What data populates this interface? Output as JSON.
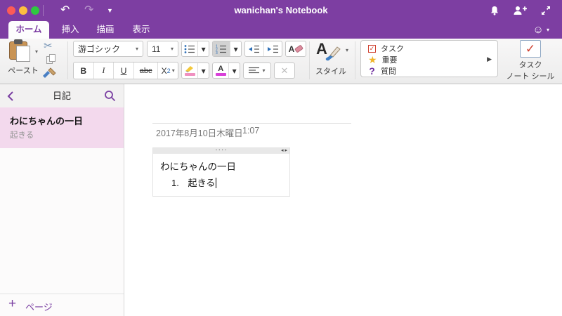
{
  "titlebar": {
    "title": "wanichan's Notebook"
  },
  "tabs": {
    "home": "ホーム",
    "insert": "挿入",
    "draw": "描画",
    "view": "表示"
  },
  "ribbon": {
    "paste_label": "ペースト",
    "font_name": "游ゴシック",
    "font_size": "11",
    "bold": "B",
    "italic": "I",
    "underline": "U",
    "strikethrough": "abc",
    "subscript_base": "X",
    "subscript_sub": "2",
    "clear_format_letter": "A",
    "font_color_letter": "A",
    "style_letter": "A",
    "style_label": "スタイル",
    "tags": {
      "task": "タスク",
      "important": "重要",
      "question": "質問"
    },
    "tag_button_line1": "タスク",
    "tag_button_line2": "ノート シール"
  },
  "sidebar": {
    "section_title": "日記",
    "page_title": "わにちゃんの一日",
    "page_preview": "起きる",
    "new_page_label": "ページ"
  },
  "editor": {
    "date": "2017年8月10日木曜日",
    "time": "1:07",
    "note_title": "わにちゃんの一日",
    "list_number": "1.",
    "list_text": "起きる",
    "handle_dots": "····",
    "handle_arrows": "◂ ▸"
  },
  "icons": {
    "undo": "↶",
    "redo": "↷",
    "caret": "▼",
    "caret_small": "▾",
    "scissors": "✂",
    "smiley": "☺",
    "star": "★",
    "question": "?",
    "check": "✓",
    "x": "✕",
    "plus": "+",
    "arrow_right": "▶"
  },
  "colors": {
    "accent_purple": "#7d3ea2",
    "selected_page_pink": "#f3d9ed",
    "tag_red": "#cf4130",
    "star_gold": "#f0b429",
    "question_purple": "#7030a0",
    "list_blue": "#2e6fb7"
  }
}
